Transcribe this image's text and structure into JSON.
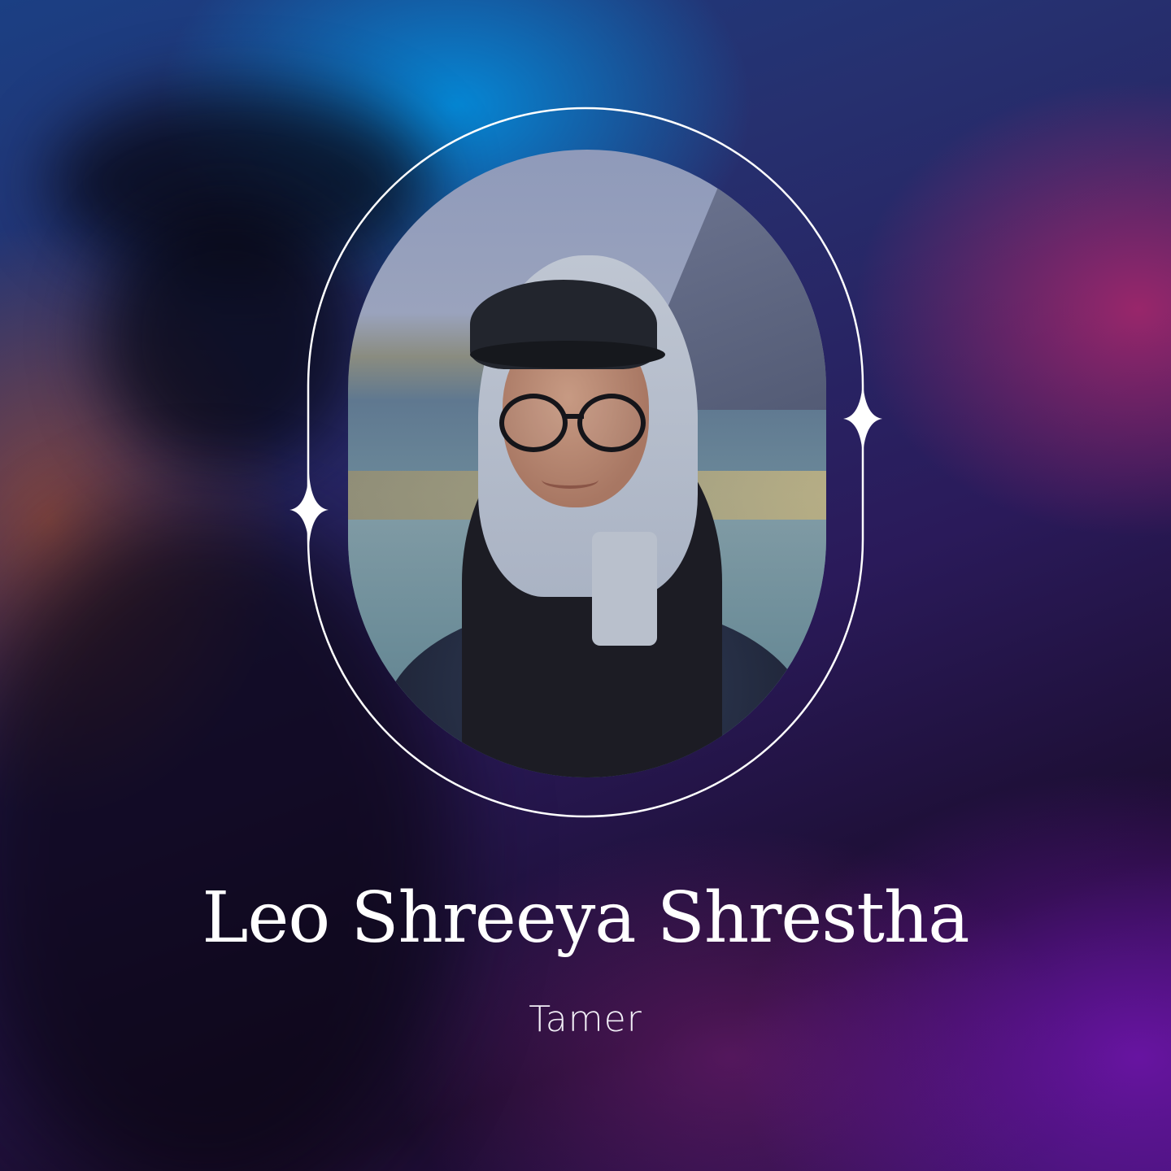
{
  "profile": {
    "name": "Leo Shreeya Shrestha",
    "role": "Tamer"
  },
  "icons": {
    "left_sparkle": "sparkle-icon",
    "right_sparkle": "sparkle-icon"
  },
  "colors": {
    "text": "#ffffff",
    "frame_line": "#ffffff",
    "accent_blue": "#0096e6",
    "accent_purple": "#6e14aa",
    "accent_magenta": "#be286e"
  }
}
